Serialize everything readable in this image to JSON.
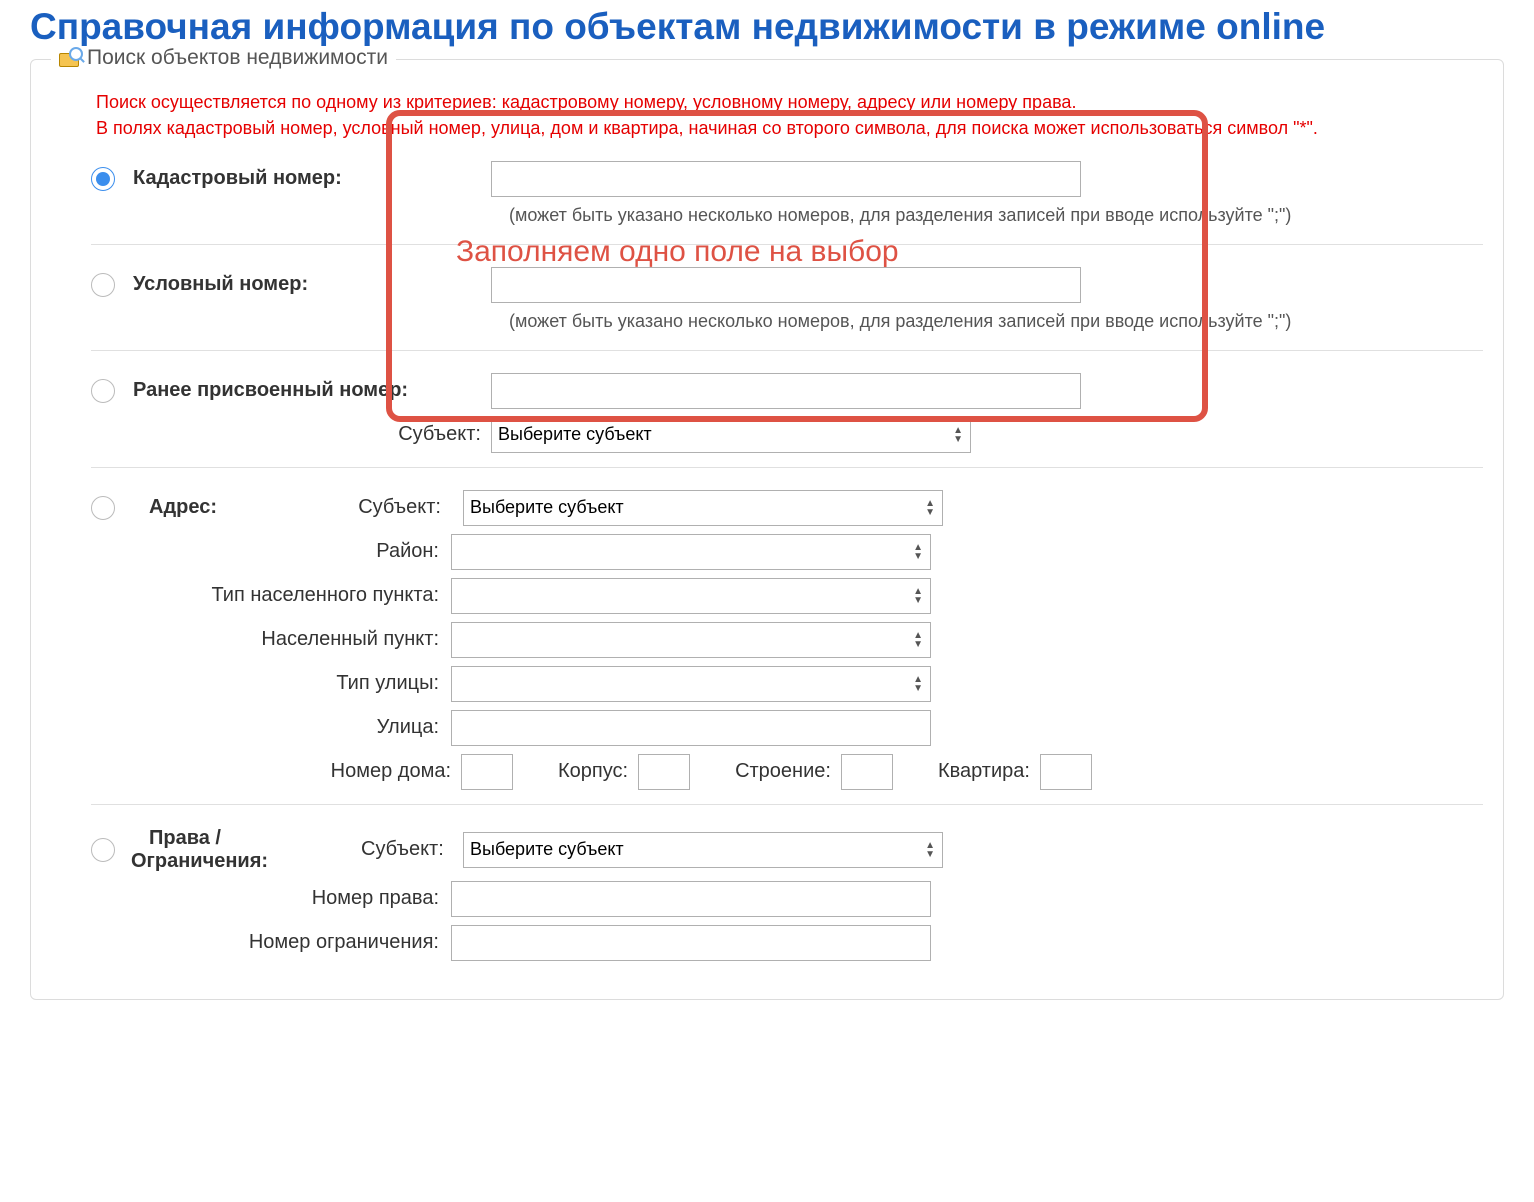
{
  "page_title": "Справочная информация по объектам недвижимости в режиме online",
  "panel_title": "Поиск объектов недвижимости",
  "info_line1": "Поиск осуществляется по одному из критериев: кадастровому номеру, условному номеру, адресу или номеру права.",
  "info_line2": "В полях кадастровый номер, условный номер, улица, дом и квартира, начиная со второго символа, для поиска может использоваться символ \"*\".",
  "overlay_text": "Заполняем одно поле на выбор",
  "criteria": {
    "cadastral": {
      "label": "Кадастровый номер:",
      "hint": "(может быть указано несколько номеров, для разделения записей при вводе используйте \";\")"
    },
    "conditional": {
      "label": "Условный номер:",
      "hint": "(может быть указано несколько номеров, для разделения записей при вводе используйте \";\")"
    },
    "previous": {
      "label": "Ранее присвоенный номер:",
      "subject_label": "Субъект:",
      "subject_value": "Выберите субъект"
    },
    "address": {
      "label": "Адрес:",
      "fields": {
        "subject": {
          "label": "Субъект:",
          "value": "Выберите субъект"
        },
        "district": {
          "label": "Район:"
        },
        "settlement_type": {
          "label": "Тип населенного пункта:"
        },
        "settlement": {
          "label": "Населенный пункт:"
        },
        "street_type": {
          "label": "Тип улицы:"
        },
        "street": {
          "label": "Улица:"
        },
        "house": {
          "label": "Номер дома:"
        },
        "corpus": {
          "label": "Корпус:"
        },
        "building": {
          "label": "Строение:"
        },
        "apartment": {
          "label": "Квартира:"
        }
      }
    },
    "rights": {
      "label": "Права / Ограничения:",
      "subject": {
        "label": "Субъект:",
        "value": "Выберите субъект"
      },
      "right_number": {
        "label": "Номер права:"
      },
      "restriction_number": {
        "label": "Номер ограничения:"
      }
    }
  }
}
